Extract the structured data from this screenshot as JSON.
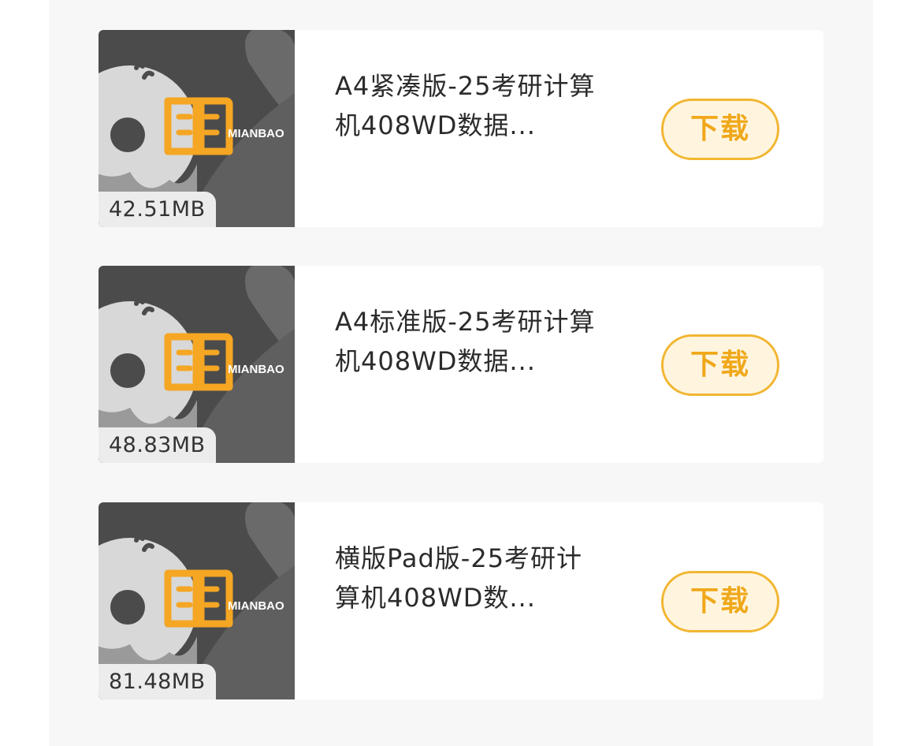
{
  "files": [
    {
      "title": "A4紧凑版-25考研计算机408WD数据...",
      "size": "42.51MB",
      "download_label": "下载",
      "thumb_text": "MIANBAO"
    },
    {
      "title": "A4标准版-25考研计算机408WD数据...",
      "size": "48.83MB",
      "download_label": "下载",
      "thumb_text": "MIANBAO"
    },
    {
      "title": "横版Pad版-25考研计算机408WD数...",
      "size": "81.48MB",
      "download_label": "下载",
      "thumb_text": "MIANBAO"
    }
  ],
  "colors": {
    "accent": "#f2b632",
    "accent_text": "#f0a81a",
    "button_bg": "#fff5df",
    "thumb_bg": "#4b4b4b"
  },
  "icons": {
    "thumbnail": "donut-book-logo-icon"
  }
}
